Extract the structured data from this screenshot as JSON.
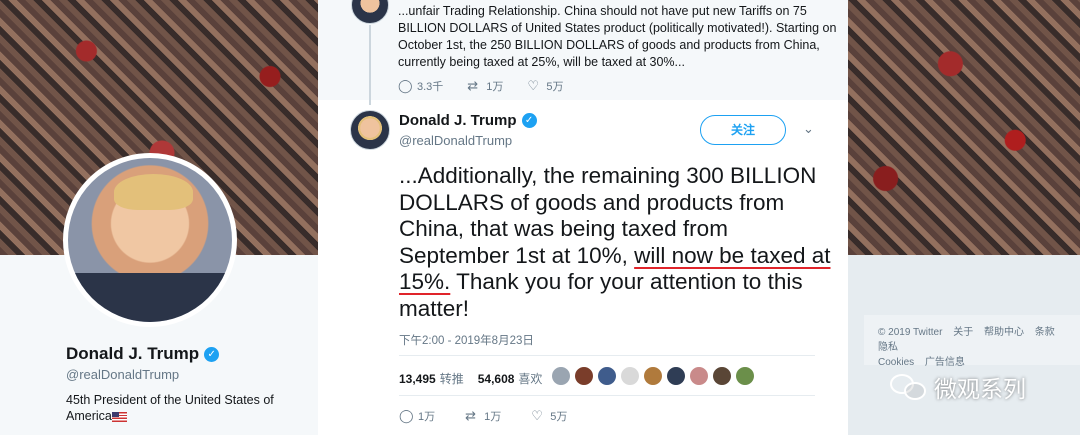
{
  "background": {
    "brand_color": "#1da1f2",
    "underline_color": "#e0242a"
  },
  "profile": {
    "name": "Donald J. Trump",
    "handle": "@realDonaldTrump",
    "bio": "45th President of the United States of America"
  },
  "previous_tweet": {
    "text": "...unfair Trading Relationship. China should not have put new Tariffs on 75 BILLION DOLLARS of United States product (politically motivated!). Starting on October 1st, the 250 BILLION DOLLARS of goods and products from China, currently being taxed at 25%, will be taxed at 30%...",
    "replies": "3.3千",
    "retweets": "1万",
    "likes": "5万"
  },
  "tweet": {
    "author_name": "Donald J. Trump",
    "author_handle": "@realDonaldTrump",
    "follow_label": "关注",
    "text_before": "...Additionally, the remaining 300 BILLION DOLLARS of goods and products from China, that was being taxed from September 1st at 10%, ",
    "text_underlined": "will now be taxed at 15%.",
    "text_after": " Thank you for your attention to this matter!",
    "timestamp": "下午2:00 - 2019年8月23日",
    "retweet_count": "13,495",
    "retweet_label": "转推",
    "like_count": "54,608",
    "like_label": "喜欢",
    "replies": "1万",
    "retweets": "1万",
    "likes": "5万"
  },
  "footer": {
    "links": [
      "© 2019 Twitter",
      "关于",
      "帮助中心",
      "条款",
      "隐私",
      "Cookies",
      "广告信息"
    ]
  },
  "watermark": {
    "text": "微观系列"
  },
  "icons": {
    "verified": "verified-badge-icon",
    "reply": "reply-icon",
    "retweet": "retweet-icon",
    "like": "heart-icon",
    "caret": "chevron-down-icon"
  }
}
